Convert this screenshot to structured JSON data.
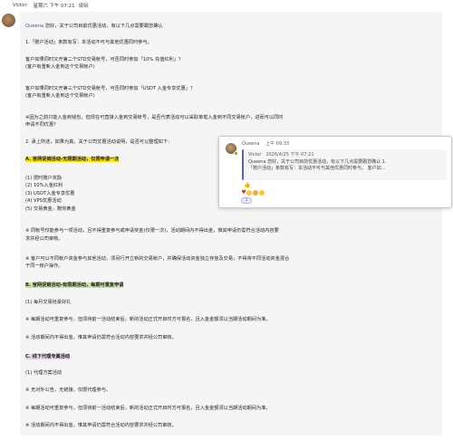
{
  "header": {
    "sender": "Victor",
    "timestamp": "星期六 下午 07:21",
    "edited": "编辑"
  },
  "message": {
    "mention": "Queena",
    "greeting": " 您好，关于公司目前优惠活动，有以下几点需要跟您确认",
    "q1": "1.「赠户活动」条款有写：本活动不可与其他优惠同时参与。",
    "q1a": "客户如果同时又开第二个STD交易帐号，可否同时参加「10% 充值红利」？",
    "q1b": "(客户有重新入金到这个交易帐户)",
    "q1c": "客户如果同时又开第三个STD交易帐号，可否同时参加「USDT 入金专享优惠」？",
    "q1d": "(客户有重新入金到这个交易帐户)",
    "q1e": "※因为之前只能入金到钱包，但现在可直接入金到交易帐号，是否代表活动可以采取单笔入金到不同交易帐户，进而可以同时",
    "q1f": "申请不同优惠？",
    "q2": "2. 承上所述，如果为真，关于公司优惠活动说明，是否可以整理如下：",
    "secA": "A. 官网促销活动-无限期活动，仅限申请一次",
    "listA": [
      "(1) 限时赠户奖励",
      "(2) 10%入金红利",
      "(3) USDT入金专享优惠",
      "(4) VPS优惠活动",
      "(5) 交易黄金，赠你黄金"
    ],
    "noteA1": "※ 同帐号仅能参与一项活动，且不得重复参与或申请奖金(仅限一次)，活动期间内不得出金，惟其申请仍需符合活动内容要",
    "noteA1b": "求并经公司审核。",
    "noteA2": "※ 客户可以不同帐户资金参与其他活动，须另行开立新的交易帐户，并确保活动资金独立存放及交易，不得将不同活动资金混合",
    "noteA2b": "于同一帐户操作。",
    "secB": "B. 官网促销活动-有限期活动，每期可重复申请",
    "listB": [
      "(1) 每月交易抢豪好礼"
    ],
    "noteB1": "※ 每期活动可重复参与，但须待前一活动结束后，新的活动正式开启时方可报名，且入金金额须以当期活动期间为准。",
    "noteB2": "※ 活动期间内不得出金，惟其申请仍需符合活动内容要求并经公司审核。",
    "secC": "C. 线下代理专属活动",
    "listC": [
      "(1) 代理方案活动"
    ],
    "noteC1": "※ 无对外公告，无链接，仅限代理参与。",
    "noteC2": "※ 每期活动可重复参与，但须待前一活动结束后，新的活动正式开启时方可报名，且入金金额须以当期活动期间为准。",
    "noteC3": "※ 活动期间内不得出金，惟其申请仍需符合活动内容要求并经公司审核。"
  },
  "reply": {
    "author": "Queena",
    "time": "上午 09:33",
    "quote_author": "Victor",
    "quote_time": "2026/4/25 下午 07:21",
    "quote_line1": "Queena 您好，关于公司目前优惠活动，有以下几点需要跟您确认 1.",
    "quote_line2": "「赠户活动」条款有写：本活动不可与其他优惠同时参与。 客户如...",
    "reaction": "👍",
    "reaction_count": "1"
  },
  "colors": {
    "highlight_a": "#fce100",
    "highlight_b": "#c6e4a0",
    "highlight_c": "#e6d1eb",
    "mention": "#4f52b2",
    "bubble": "#f5f5f5",
    "presence": "#6bb700"
  }
}
